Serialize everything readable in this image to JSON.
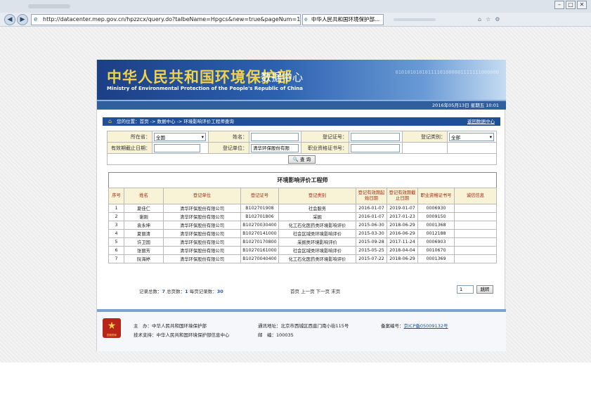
{
  "browser": {
    "url": "http://datacenter.mep.gov.cn/hpzzcx/query.do?talbeName=Hpgcs&new=true&pageNum=1",
    "tab_title": "中华人民共和国环境保护部...",
    "menu_text": "✕  ⚙ ▾"
  },
  "header": {
    "title": "中华人民共和国环境保护部",
    "subtitle": "数据中心",
    "english": "Ministry of Environmental Protection of the People's Republic of China",
    "deco": "01010101010111101000001111111000000",
    "date": "2016年05月13日 星期五 10:01"
  },
  "breadcrumb": {
    "text": "您的位置：首页 -> 数据中心 -> 环境影响评价工程师查询",
    "back_link": "返回数据中心"
  },
  "form": {
    "region_label": "所在省：",
    "region_value": "全国",
    "name_label": "姓名：",
    "name_value": "",
    "cert_label": "登记证号：",
    "cert_value": "",
    "type_label": "登记类别：",
    "type_value": "全部",
    "expiry_label": "有效期截止日期：",
    "expiry_value": "",
    "unit_label": "登记单位：",
    "unit_value": "清华环保股份有限",
    "license_label": "职业资格证书号：",
    "license_value": "",
    "query_button": "查 询"
  },
  "results": {
    "title": "环境影响评价工程师",
    "headers": [
      "序号",
      "姓名",
      "登记单位",
      "登记证号",
      "登记类别",
      "登记有效期起始日期",
      "登记有效期截止日期",
      "职业资格证书号",
      "诚信信息"
    ],
    "rows": [
      [
        "1",
        "夏佳仁",
        "清华环保股份有限公司",
        "B102701908",
        "社会服务",
        "2016-01-07",
        "2019-01-07",
        "0006930",
        ""
      ],
      [
        "2",
        "谢刚",
        "清华环保股份有限公司",
        "B102701806",
        "采掘",
        "2016-01-07",
        "2017-01-23",
        "0009150",
        ""
      ],
      [
        "3",
        "袁永坤",
        "清华环保股份有限公司",
        "B10270030400",
        "化工石化医药类环境影响评价",
        "2015-06-30",
        "2018-06-29",
        "0001368",
        ""
      ],
      [
        "4",
        "夏丽清",
        "清华环保股份有限公司",
        "B10270141000",
        "社会区域类环境影响评价",
        "2015-03-30",
        "2016-06-29",
        "0012188",
        ""
      ],
      [
        "5",
        "许卫国",
        "清华环保股份有限公司",
        "B10270170800",
        "采掘类环境影响评价",
        "2015-09-28",
        "2017-11-24",
        "0006903",
        ""
      ],
      [
        "6",
        "张丽芳",
        "清华环保股份有限公司",
        "B10270161000",
        "社会区域类环境影响评价",
        "2015-05-25",
        "2018-04-04",
        "0010670",
        ""
      ],
      [
        "7",
        "阮海婷",
        "清华环保股份有限公司",
        "B10270040400",
        "化工石化医药类环境影响评价",
        "2015-07-22",
        "2018-06-29",
        "0001369",
        ""
      ]
    ]
  },
  "pager": {
    "summary_prefix": "记录总数：",
    "total_records": "7",
    "pages_prefix": " 总页数：",
    "total_pages": "1",
    "per_page_prefix": " 每页记录数：",
    "per_page": "30",
    "links": "首页 上一页 下一页 末页",
    "page_input": "1",
    "go_button": "跳转"
  },
  "footer": {
    "host": "主　办：中华人民共和国环境保护部",
    "tech": "技术支持：中华人民共和国环境保护部信息中心",
    "address": "通讯地址：北京市西城区西直门南小街115号",
    "postcode": "邮　编：100035",
    "icp_label": "备案编号：",
    "icp_link": "京ICP备05009132号",
    "emblem_text": "国徽图案"
  }
}
